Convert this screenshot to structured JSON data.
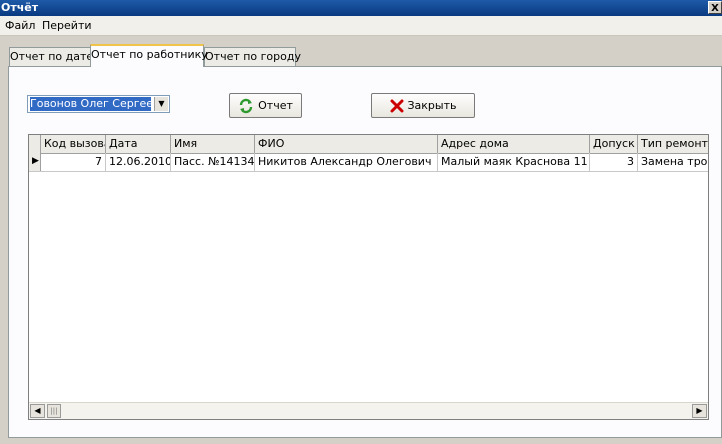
{
  "window": {
    "title": "Отчёт",
    "close_label": "X"
  },
  "menu": [
    "Файл",
    "Перейти"
  ],
  "tabs": [
    {
      "label": "Отчет по дате",
      "active": false
    },
    {
      "label": "Отчет по работнику",
      "active": true
    },
    {
      "label": "Отчет по городу",
      "active": false
    }
  ],
  "employee_select": {
    "value": "Говонов Олег Сергеевич"
  },
  "buttons": {
    "report": {
      "label": "Отчет",
      "icon": "refresh-icon"
    },
    "close": {
      "label": "Закрыть",
      "icon": "close-x-icon"
    }
  },
  "grid": {
    "columns": [
      "Код вызова",
      "Дата",
      "Имя",
      "ФИО",
      "Адрес дома",
      "Допуск",
      "Тип ремонта"
    ],
    "rows": [
      {
        "current": true,
        "cells": [
          "7",
          "12.06.2010",
          "Пасс. №14134",
          "Никитов Александр Олегович",
          "Малый маяк Краснова 11",
          "3",
          "Замена трос"
        ]
      }
    ]
  },
  "colors": {
    "title_bar": "#0a3a80",
    "selection": "#316ac5",
    "close_icon": "#cc0000",
    "refresh_icon": "#2e9a2e"
  }
}
